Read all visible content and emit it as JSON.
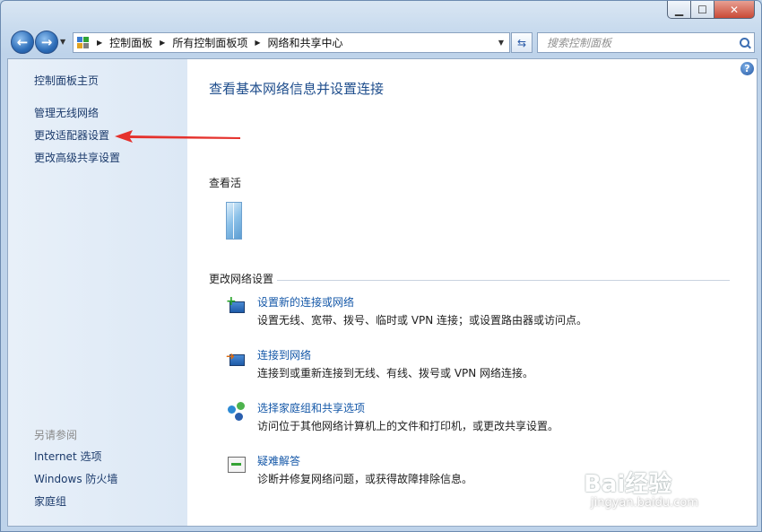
{
  "window": {
    "controls": {
      "minimize": "▁",
      "maximize": "☐",
      "close": "✕"
    }
  },
  "navbar": {
    "back_icon": "back-arrow-icon",
    "forward_icon": "forward-arrow-icon",
    "breadcrumbs": [
      "控制面板",
      "所有控制面板项",
      "网络和共享中心"
    ],
    "search_placeholder": "搜索控制面板"
  },
  "sidebar": {
    "home": "控制面板主页",
    "items": [
      "管理无线网络",
      "更改适配器设置",
      "更改高级共享设置"
    ],
    "see_also_title": "另请参阅",
    "see_also": [
      "Internet 选项",
      "Windows 防火墙",
      "家庭组"
    ]
  },
  "main": {
    "title": "查看基本网络信息并设置连接",
    "active_label": "查看活",
    "change_settings_label": "更改网络设置",
    "tasks": [
      {
        "link": "设置新的连接或网络",
        "desc": "设置无线、宽带、拨号、临时或 VPN 连接；或设置路由器或访问点。",
        "icon": "new-connection-icon"
      },
      {
        "link": "连接到网络",
        "desc": "连接到或重新连接到无线、有线、拨号或 VPN 网络连接。",
        "icon": "connect-network-icon"
      },
      {
        "link": "选择家庭组和共享选项",
        "desc": "访问位于其他网络计算机上的文件和打印机，或更改共享设置。",
        "icon": "homegroup-icon"
      },
      {
        "link": "疑难解答",
        "desc": "诊断并修复网络问题，或获得故障排除信息。",
        "icon": "troubleshoot-icon"
      }
    ]
  },
  "watermark": {
    "brand": "Bai经验",
    "url": "jingyan.baidu.com"
  },
  "colors": {
    "link": "#1558a8",
    "title": "#1e4d8c",
    "annotation_arrow": "#e5322d"
  }
}
